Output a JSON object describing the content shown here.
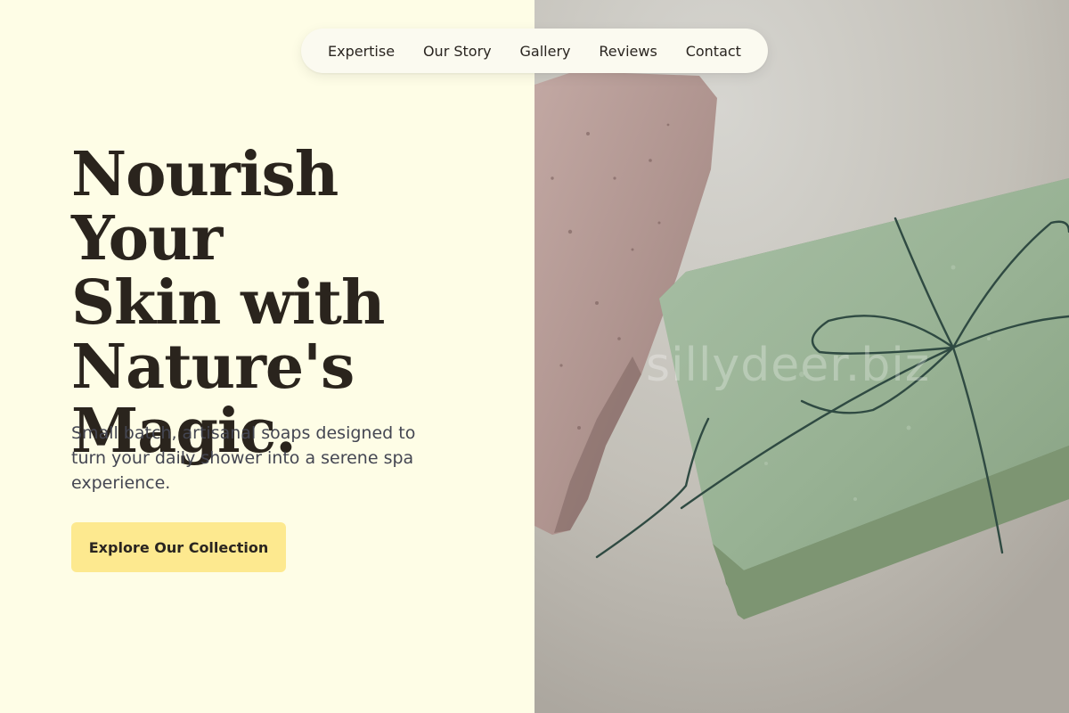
{
  "nav": {
    "items": [
      {
        "label": "Expertise"
      },
      {
        "label": "Our Story"
      },
      {
        "label": "Gallery"
      },
      {
        "label": "Reviews"
      },
      {
        "label": "Contact"
      }
    ]
  },
  "hero": {
    "headline_lines": [
      "Nourish Your",
      "Skin with",
      "Nature's",
      "Magic."
    ],
    "subtext": "Small batch, artisanal soaps designed to turn your daily shower into a serene spa experience.",
    "cta_label": "Explore Our Collection",
    "watermark": "sillydeer.biz"
  },
  "colors": {
    "background": "#fefde6",
    "button": "#fde98f",
    "heading_text": "#2a241d",
    "body_text": "#444652",
    "soap_green": "#8fa88c",
    "soap_pink": "#b49b96"
  }
}
